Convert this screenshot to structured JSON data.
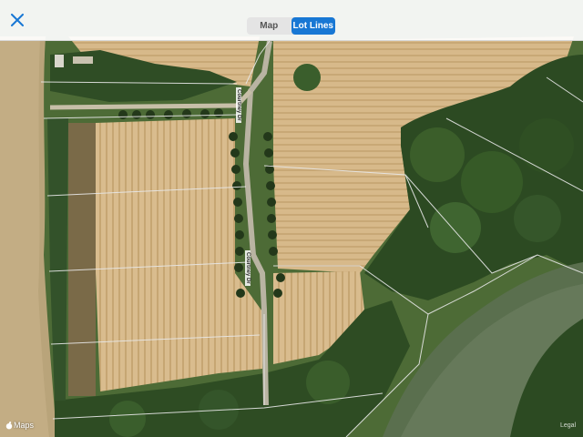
{
  "header": {
    "close_icon": "close-icon",
    "tabs": [
      {
        "label": "Map",
        "selected": false
      },
      {
        "label": "Lot Lines",
        "selected": true
      }
    ]
  },
  "map": {
    "type": "satellite",
    "road_labels": [
      "Courtney Dr",
      "Courtney Dr"
    ],
    "attribution": "Maps",
    "attribution_icon": "apple-logo-icon",
    "legal_text": "Legal",
    "colors": {
      "accent": "#1877d4",
      "lot_line": "#e8e8e8"
    }
  }
}
